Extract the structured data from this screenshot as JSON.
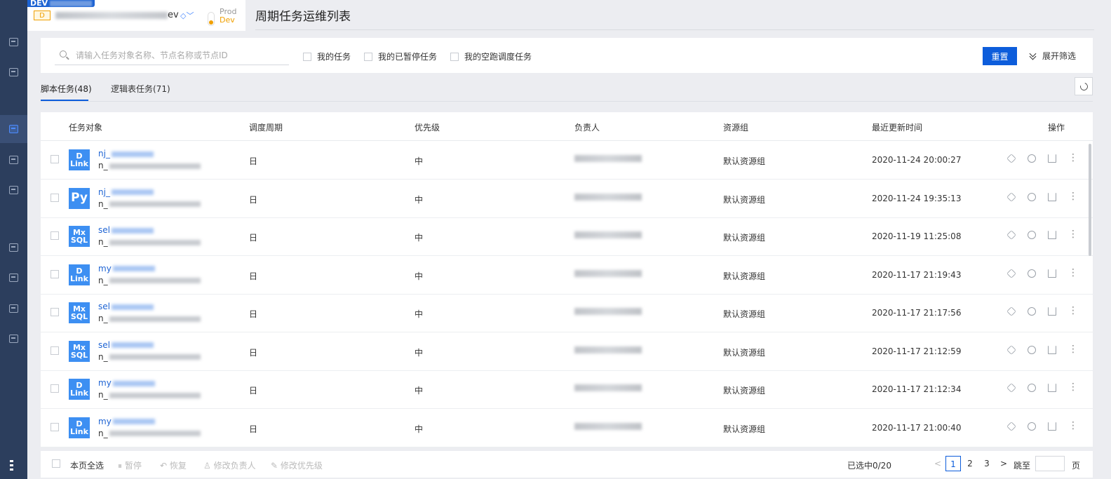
{
  "project": {
    "env_tag": "DEV",
    "badge": "D",
    "name_suffix": "ev",
    "env_prod": "Prod",
    "env_dev": "Dev"
  },
  "page_title": "周期任务运维列表",
  "filter": {
    "search_placeholder": "请输入任务对象名称、节点名称或节点ID",
    "checkboxes": [
      "我的任务",
      "我的已暂停任务",
      "我的空跑调度任务"
    ],
    "reset_label": "重置",
    "expand_label": "展开筛选"
  },
  "tabs": [
    "脚本任务(48)",
    "逻辑表任务(71)"
  ],
  "table": {
    "headers": {
      "object": "任务对象",
      "cycle": "调度周期",
      "priority": "优先级",
      "owner": "负责人",
      "resource": "资源组",
      "updated": "最近更新时间",
      "ops": "操作"
    },
    "rows": [
      {
        "icon": "dlink",
        "icon_l1": "D",
        "icon_l2": "Link",
        "name": "nj_",
        "node": "n_",
        "cycle": "日",
        "priority": "中",
        "resource": "默认资源组",
        "updated": "2020-11-24 20:00:27"
      },
      {
        "icon": "python",
        "icon_l1": "Py",
        "icon_l2": "",
        "name": "nj_",
        "node": "n_",
        "cycle": "日",
        "priority": "中",
        "resource": "默认资源组",
        "updated": "2020-11-24 19:35:13"
      },
      {
        "icon": "mxsql",
        "icon_l1": "Mx",
        "icon_l2": "SQL",
        "name": "sel",
        "node": "n_",
        "cycle": "日",
        "priority": "中",
        "resource": "默认资源组",
        "updated": "2020-11-19 11:25:08"
      },
      {
        "icon": "dlink",
        "icon_l1": "D",
        "icon_l2": "Link",
        "name": "my",
        "node": "n_",
        "cycle": "日",
        "priority": "中",
        "resource": "默认资源组",
        "updated": "2020-11-17 21:19:43"
      },
      {
        "icon": "mxsql",
        "icon_l1": "Mx",
        "icon_l2": "SQL",
        "name": "sel",
        "node": "n_",
        "cycle": "日",
        "priority": "中",
        "resource": "默认资源组",
        "updated": "2020-11-17 21:17:56"
      },
      {
        "icon": "mxsql",
        "icon_l1": "Mx",
        "icon_l2": "SQL",
        "name": "sel",
        "node": "n_",
        "cycle": "日",
        "priority": "中",
        "resource": "默认资源组",
        "updated": "2020-11-17 21:12:59"
      },
      {
        "icon": "dlink",
        "icon_l1": "D",
        "icon_l2": "Link",
        "name": "my",
        "node": "n_",
        "cycle": "日",
        "priority": "中",
        "resource": "默认资源组",
        "updated": "2020-11-17 21:12:34"
      },
      {
        "icon": "dlink",
        "icon_l1": "D",
        "icon_l2": "Link",
        "name": "my",
        "node": "n_",
        "cycle": "日",
        "priority": "中",
        "resource": "默认资源组",
        "updated": "2020-11-17 21:00:40"
      }
    ]
  },
  "footer": {
    "select_all": "本页全选",
    "pause": "暂停",
    "resume": "恢复",
    "change_owner": "修改负责人",
    "change_priority": "修改优先级",
    "selected": "已选中0/20",
    "pages": [
      "1",
      "2",
      "3"
    ],
    "current_page": "1",
    "jump_to": "跳至",
    "page_unit": "页"
  }
}
